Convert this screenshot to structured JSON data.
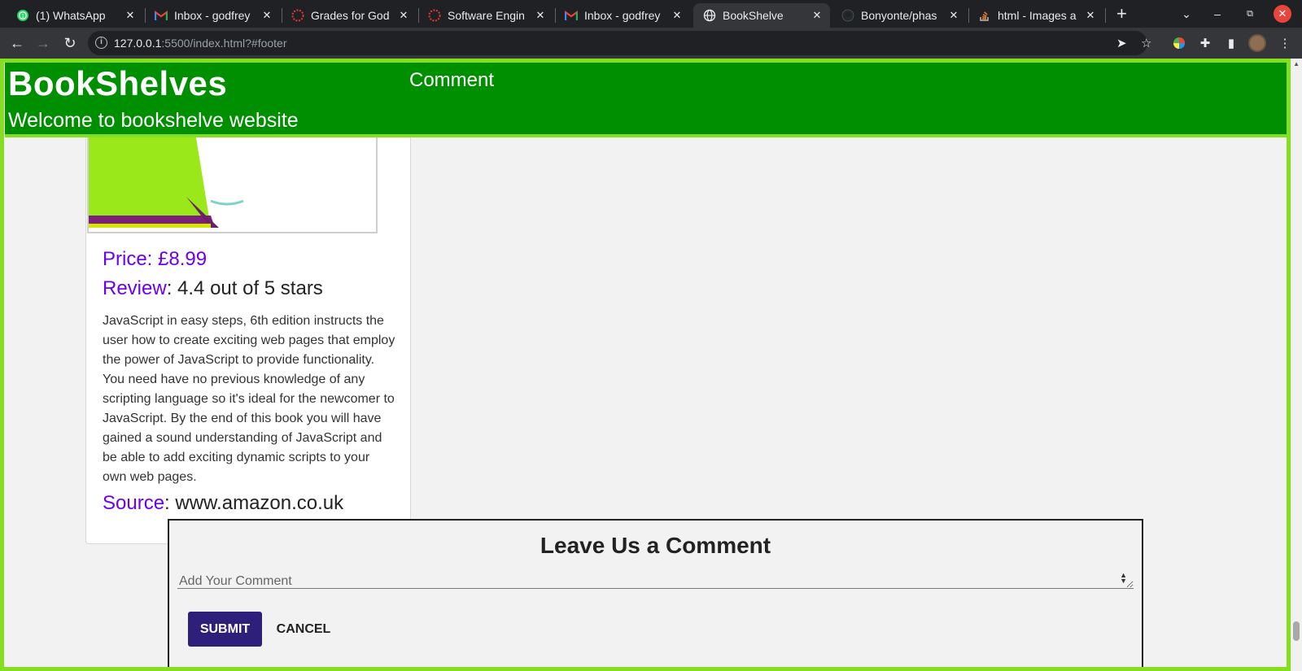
{
  "browser": {
    "tabs": [
      {
        "title": "(1) WhatsApp",
        "icon": "whatsapp-icon"
      },
      {
        "title": "Inbox - godfrey",
        "icon": "gmail-icon"
      },
      {
        "title": "Grades for God",
        "icon": "dotted-circle-icon"
      },
      {
        "title": "Software Engin",
        "icon": "dotted-circle-icon"
      },
      {
        "title": "Inbox - godfrey",
        "icon": "gmail-icon"
      },
      {
        "title": "BookShelve",
        "icon": "globe-icon",
        "active": true
      },
      {
        "title": "Bonyonte/phas",
        "icon": "github-icon"
      },
      {
        "title": "html - Images a",
        "icon": "stackoverflow-icon"
      }
    ],
    "url_host": "127.0.0.1",
    "url_rest": ":5500/index.html?#footer"
  },
  "site": {
    "title": "BookShelves",
    "subtitle": "Welcome to bookshelve website",
    "nav_link": "Comment"
  },
  "book": {
    "price": "Price: £8.99",
    "review_label": "Review",
    "review_value": ": 4.4 out of 5 stars",
    "description": "JavaScript in easy steps, 6th edition instructs the user how to create exciting web pages that employ the power of JavaScript to provide functionality. You need have no previous knowledge of any scripting language so it's ideal for the newcomer to JavaScript. By the end of this book you will have gained a sound understanding of JavaScript and be able to add exciting dynamic scripts to your own web pages.",
    "source_label": "Source",
    "source_value": ": www.amazon.co.uk"
  },
  "comment": {
    "title": "Leave Us a Comment",
    "placeholder": "Add Your Comment",
    "submit_label": "SUBMIT",
    "cancel_label": "CANCEL"
  },
  "colors": {
    "header_green": "#008f00",
    "border_lime": "#84e01f",
    "label_purple": "#6a00f4",
    "submit_bg": "#2e1f7a"
  }
}
